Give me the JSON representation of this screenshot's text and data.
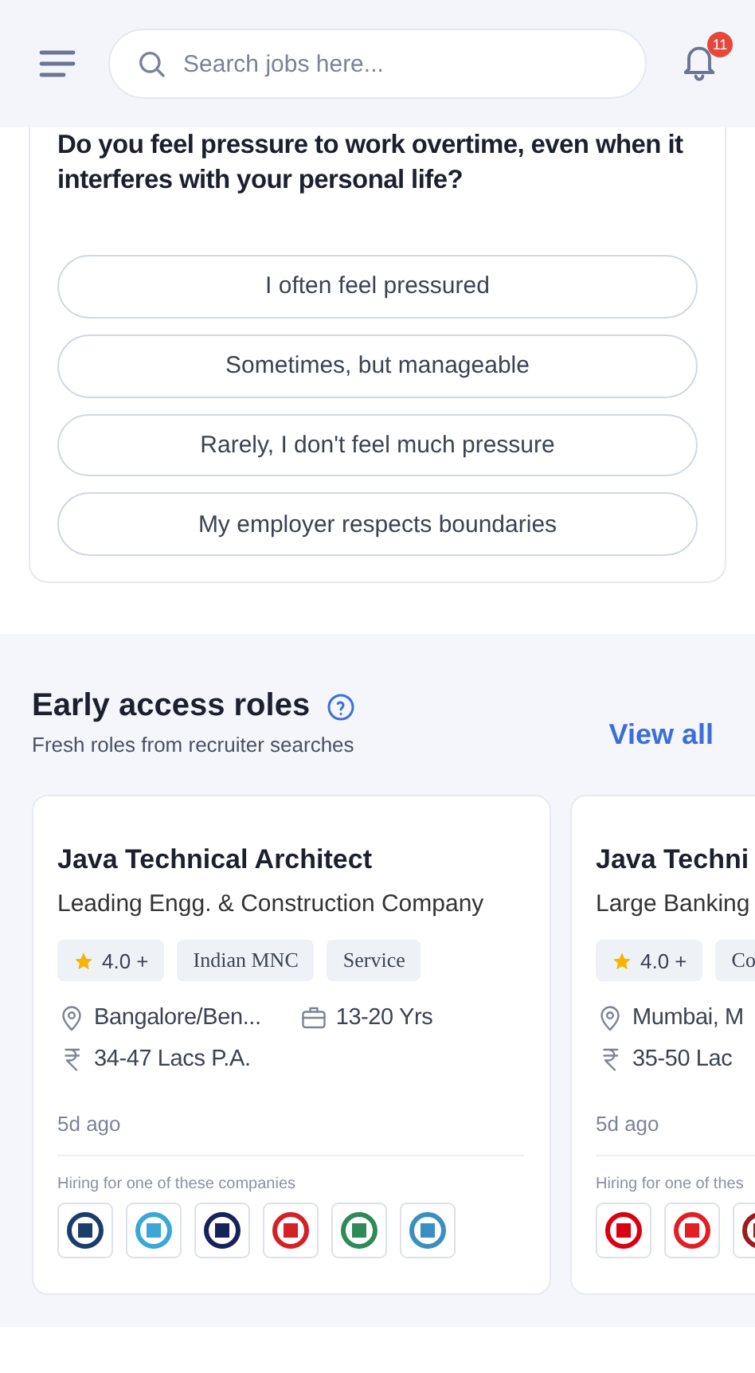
{
  "header": {
    "search": {
      "placeholder": "Search jobs here..."
    },
    "notifications": {
      "count": "11"
    }
  },
  "poll": {
    "question": "Do you feel pressure to work overtime, even when it interferes with your personal life?",
    "options": [
      {
        "label": "I often feel pressured",
        "selected": false
      },
      {
        "label": "Sometimes, but manageable",
        "selected": false
      },
      {
        "label": "Rarely, I don't feel much pressure",
        "selected": false
      },
      {
        "label": "My employer respects boundaries",
        "selected": false
      }
    ]
  },
  "section": {
    "title": "Early access roles",
    "subtitle": "Fresh roles from recruiter searches",
    "link": "View all"
  },
  "jobs": [
    {
      "title": "Java Technical Architect",
      "company": "Leading Engg. & Construction Company",
      "tags": [
        {
          "kind": "rating",
          "label": "4.0 +"
        },
        {
          "kind": "plain",
          "label": "Indian MNC"
        },
        {
          "kind": "plain",
          "label": "Service"
        }
      ],
      "location": "Bangalore/Ben...",
      "experience": "13-20 Yrs",
      "salary": "34-47 Lacs P.A.",
      "posted": "5d ago",
      "hiring_note": "Hiring for one of these companies",
      "logos": [
        {
          "color": "#1a3d6e"
        },
        {
          "color": "#3aa7d8"
        },
        {
          "color": "#16235a"
        },
        {
          "color": "#d62027"
        },
        {
          "color": "#2e8b57"
        },
        {
          "color": "#3b8fc0"
        }
      ]
    },
    {
      "title": "Java Techni",
      "company": "Large Banking",
      "tags": [
        {
          "kind": "rating",
          "label": "4.0 +"
        },
        {
          "kind": "plain",
          "label": "Co"
        }
      ],
      "location": "Mumbai, M",
      "salary": "35-50 Lac",
      "posted": "5d ago",
      "hiring_note": "Hiring for one of thes",
      "logos": [
        {
          "color": "#db0011"
        },
        {
          "color": "#e31e24"
        },
        {
          "color": "#9b1c20"
        }
      ]
    }
  ]
}
